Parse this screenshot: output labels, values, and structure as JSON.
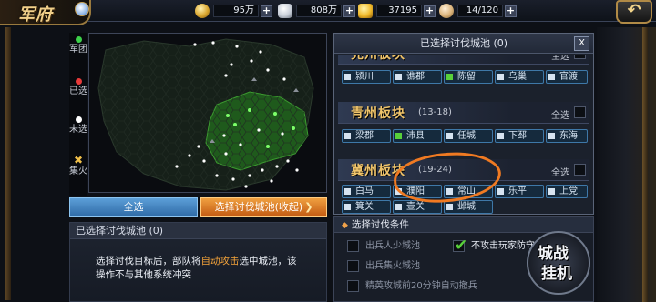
{
  "header": {
    "title": "军府",
    "resources": [
      {
        "icon": "grain-icon",
        "value": "95万"
      },
      {
        "icon": "silver-coin-icon",
        "value": "808万"
      },
      {
        "icon": "gold-ingot-icon",
        "value": "37195"
      },
      {
        "icon": "food-bag-icon",
        "value": "14/120"
      }
    ],
    "plus": "+",
    "back_icon": "back-arrow-icon"
  },
  "legend": [
    {
      "label": "军团",
      "color": "#3cd04a"
    },
    {
      "label": "已选",
      "color": "#e83a3a"
    },
    {
      "label": "未选",
      "color": "#ffffff"
    },
    {
      "label": "集火",
      "color": "#f2c14a"
    }
  ],
  "map_buttons": {
    "select_all": "全选",
    "select_cities": "选择讨伐城池(收起)"
  },
  "selected_panel": {
    "header": "已选择讨伐城池 (0)",
    "desc_before": "选择讨伐目标后，部队将",
    "desc_highlight": "自动攻击",
    "desc_after": "选中城池，该操作不与其他系统冲突"
  },
  "right_panel": {
    "title": "已选择讨伐城池 (0)",
    "close": "X",
    "select_all": "全选",
    "regions": [
      {
        "name": "兖州板块",
        "range": "",
        "cities": [
          {
            "name": "颍川",
            "selected": false
          },
          {
            "name": "谯郡",
            "selected": false
          },
          {
            "name": "陈留",
            "selected": true
          },
          {
            "name": "乌巢",
            "selected": false
          },
          {
            "name": "官渡",
            "selected": false
          }
        ]
      },
      {
        "name": "青州板块",
        "range": "(13-18)",
        "cities": [
          {
            "name": "梁郡",
            "selected": false
          },
          {
            "name": "沛县",
            "selected": true
          },
          {
            "name": "任城",
            "selected": false
          },
          {
            "name": "下邳",
            "selected": false
          },
          {
            "name": "东海",
            "selected": false
          }
        ]
      },
      {
        "name": "冀州板块",
        "range": "(19-24)",
        "cities": [
          {
            "name": "白马",
            "selected": false
          },
          {
            "name": "濮阳",
            "selected": false
          },
          {
            "name": "常山",
            "selected": false
          },
          {
            "name": "乐平",
            "selected": false
          },
          {
            "name": "上党",
            "selected": false
          },
          {
            "name": "箕关",
            "selected": false
          },
          {
            "name": "壶关",
            "selected": false
          },
          {
            "name": "邺城",
            "selected": false
          }
        ]
      }
    ]
  },
  "conditions": {
    "header": "选择讨伐条件",
    "options": [
      {
        "label": "出兵人少城池",
        "checked": false
      },
      {
        "label": "不攻击玩家防守城池",
        "checked": true
      },
      {
        "label": "出兵集火城池",
        "checked": false
      },
      {
        "label": "精英攻城前20分钟自动撤兵",
        "checked": false
      }
    ]
  },
  "emblem": {
    "line1": "城战",
    "line2": "挂机"
  },
  "colors": {
    "accent_orange": "#f07a22",
    "selected_green": "#58d03a",
    "button_blue": "#2f6aa6",
    "button_orange": "#c25a12"
  }
}
